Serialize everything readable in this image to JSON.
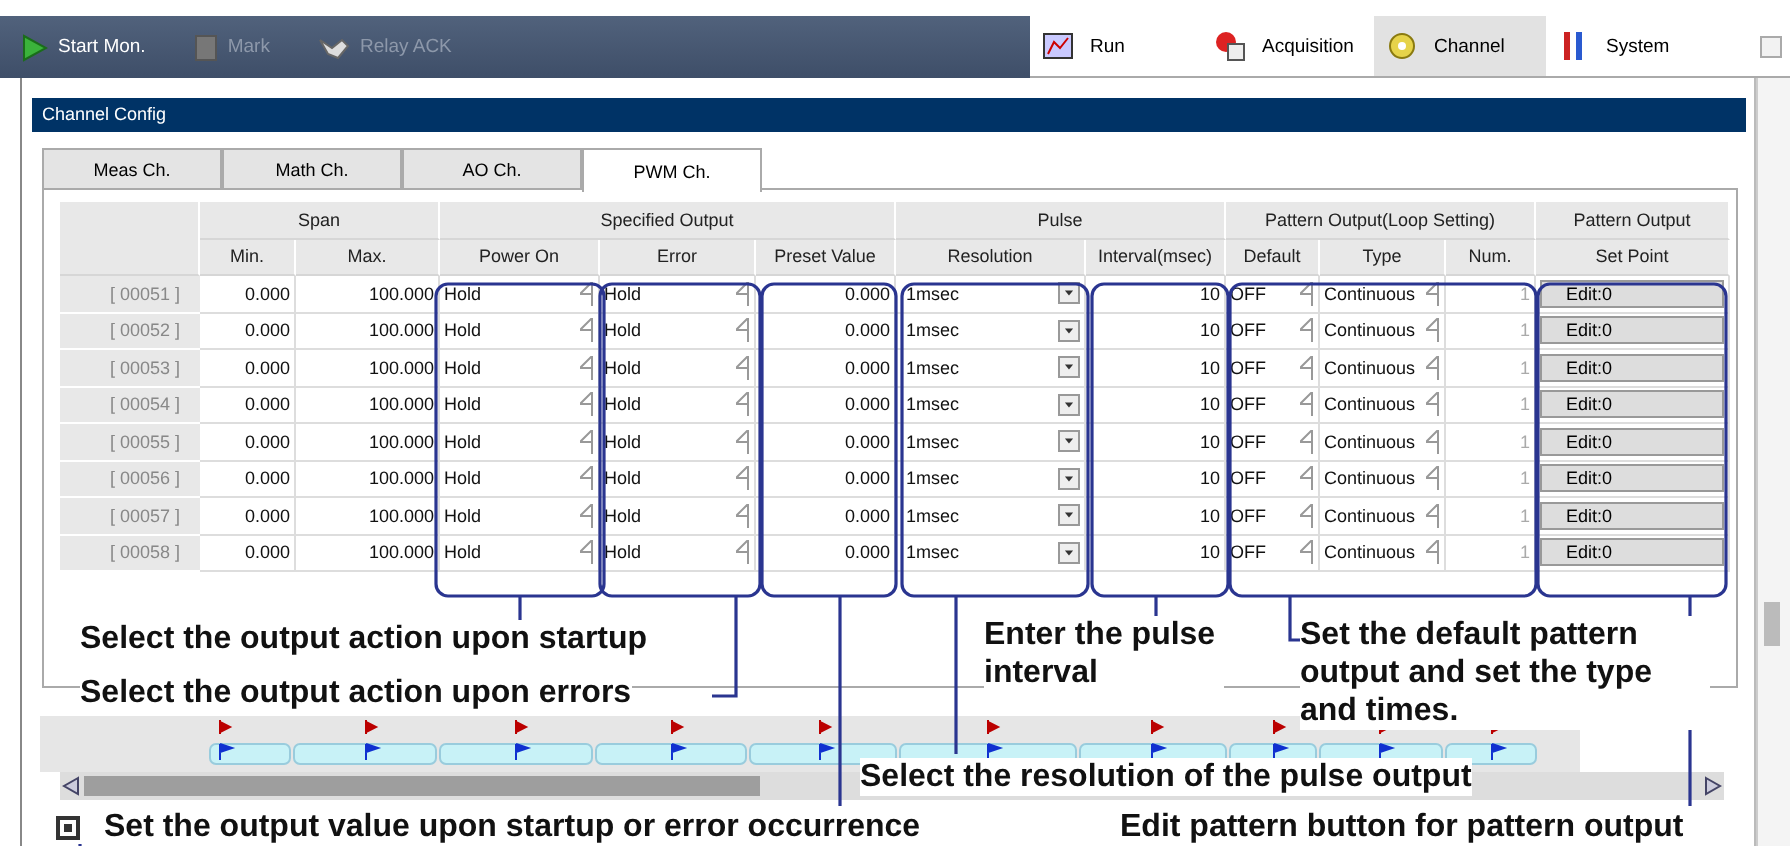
{
  "toolbar": {
    "buttons": [
      {
        "label": "Start Mon.",
        "disabled": false
      },
      {
        "label": "Mark",
        "disabled": true
      },
      {
        "label": "Relay ACK",
        "disabled": true
      }
    ]
  },
  "nav_tabs": [
    {
      "label": "Run",
      "selected": false
    },
    {
      "label": "Acquisition",
      "selected": false
    },
    {
      "label": "Channel",
      "selected": true
    },
    {
      "label": "System",
      "selected": false
    }
  ],
  "panel": {
    "title": "Channel Config"
  },
  "tabs": [
    {
      "label": "Meas Ch.",
      "selected": false
    },
    {
      "label": "Math Ch.",
      "selected": false
    },
    {
      "label": "AO Ch.",
      "selected": false
    },
    {
      "label": "PWM Ch.",
      "selected": true
    }
  ],
  "table": {
    "column_groups": [
      {
        "label": "Span",
        "columns": [
          "Min.",
          "Max."
        ]
      },
      {
        "label": "Specified Output",
        "columns": [
          "Power On",
          "Error",
          "Preset Value"
        ]
      },
      {
        "label": "Pulse",
        "columns": [
          "Resolution",
          "Interval(msec)"
        ]
      },
      {
        "label": "Pattern Output(Loop Setting)",
        "columns": [
          "Default",
          "Type",
          "Num."
        ]
      },
      {
        "label": "Pattern Output",
        "columns": [
          "Set Point"
        ]
      }
    ],
    "rows": [
      {
        "channel": "[ 00051 ]",
        "min": "0.000",
        "max": "100.000",
        "power_on": "Hold",
        "error": "Hold",
        "preset_value": "0.000",
        "resolution": "1msec",
        "interval": "10",
        "default": "OFF",
        "type": "Continuous",
        "num": "1",
        "set_point": "Edit:0"
      },
      {
        "channel": "[ 00052 ]",
        "min": "0.000",
        "max": "100.000",
        "power_on": "Hold",
        "error": "Hold",
        "preset_value": "0.000",
        "resolution": "1msec",
        "interval": "10",
        "default": "OFF",
        "type": "Continuous",
        "num": "1",
        "set_point": "Edit:0"
      },
      {
        "channel": "[ 00053 ]",
        "min": "0.000",
        "max": "100.000",
        "power_on": "Hold",
        "error": "Hold",
        "preset_value": "0.000",
        "resolution": "1msec",
        "interval": "10",
        "default": "OFF",
        "type": "Continuous",
        "num": "1",
        "set_point": "Edit:0"
      },
      {
        "channel": "[ 00054 ]",
        "min": "0.000",
        "max": "100.000",
        "power_on": "Hold",
        "error": "Hold",
        "preset_value": "0.000",
        "resolution": "1msec",
        "interval": "10",
        "default": "OFF",
        "type": "Continuous",
        "num": "1",
        "set_point": "Edit:0"
      },
      {
        "channel": "[ 00055 ]",
        "min": "0.000",
        "max": "100.000",
        "power_on": "Hold",
        "error": "Hold",
        "preset_value": "0.000",
        "resolution": "1msec",
        "interval": "10",
        "default": "OFF",
        "type": "Continuous",
        "num": "1",
        "set_point": "Edit:0"
      },
      {
        "channel": "[ 00056 ]",
        "min": "0.000",
        "max": "100.000",
        "power_on": "Hold",
        "error": "Hold",
        "preset_value": "0.000",
        "resolution": "1msec",
        "interval": "10",
        "default": "OFF",
        "type": "Continuous",
        "num": "1",
        "set_point": "Edit:0"
      },
      {
        "channel": "[ 00057 ]",
        "min": "0.000",
        "max": "100.000",
        "power_on": "Hold",
        "error": "Hold",
        "preset_value": "0.000",
        "resolution": "1msec",
        "interval": "10",
        "default": "OFF",
        "type": "Continuous",
        "num": "1",
        "set_point": "Edit:0"
      },
      {
        "channel": "[ 00058 ]",
        "min": "0.000",
        "max": "100.000",
        "power_on": "Hold",
        "error": "Hold",
        "preset_value": "0.000",
        "resolution": "1msec",
        "interval": "10",
        "default": "OFF",
        "type": "Continuous",
        "num": "1",
        "set_point": "Edit:0"
      }
    ]
  },
  "checkbox": {
    "checked": true
  },
  "annotations": [
    {
      "text": "Select the output action upon startup"
    },
    {
      "text": "Select the output action upon errors"
    },
    {
      "text": "Enter the pulse interval"
    },
    {
      "text": "Set the default pattern output and set the type and times."
    },
    {
      "text": "Select the resolution of the pulse output"
    },
    {
      "text": "Set the output value upon startup or error occurrence"
    },
    {
      "text": "Edit pattern button for pattern output"
    }
  ]
}
